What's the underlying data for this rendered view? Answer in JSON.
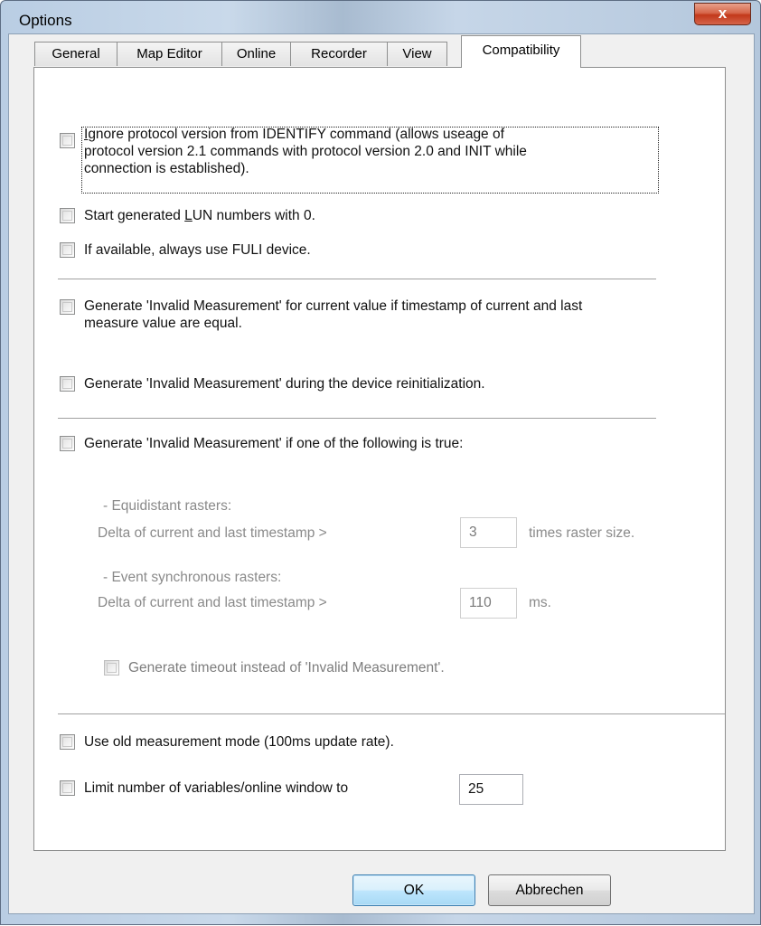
{
  "window": {
    "title": "Options",
    "close_glyph": "x"
  },
  "tabs": [
    {
      "label": "General"
    },
    {
      "label": "Map Editor"
    },
    {
      "label": "Online"
    },
    {
      "label": "Recorder"
    },
    {
      "label": "View"
    },
    {
      "label": "Compatibility",
      "active": true
    }
  ],
  "compatibility": {
    "ignore_protocol": {
      "line1_rest": "gnore protocol version from IDENTIFY command (allows useage of",
      "line1_mnemonic": "I",
      "line2": "protocol version 2.1 commands with protocol version 2.0 and INIT while",
      "line3": "connection is established).",
      "checked": false
    },
    "start_lun": {
      "prefix": "Start generated ",
      "mnemonic": "L",
      "suffix": "UN numbers with 0.",
      "checked": false
    },
    "fuli": {
      "label": "If available, always use FULI device.",
      "checked": false
    },
    "invalid_equal_ts": {
      "line1": "Generate 'Invalid Measurement' for current value if timestamp of current and last",
      "line2": "measure value are equal.",
      "checked": false
    },
    "invalid_reinit": {
      "label": "Generate 'Invalid Measurement' during the device reinitialization.",
      "checked": false
    },
    "invalid_conditions": {
      "label": "Generate 'Invalid Measurement' if one of the following is true:",
      "checked": false
    },
    "equidistant": {
      "heading": "- Equidistant rasters:",
      "delta_label": "Delta of current and last timestamp >",
      "value": "3",
      "unit": "times raster size."
    },
    "event_sync": {
      "heading": "- Event synchronous rasters:",
      "delta_label": "Delta of current and last timestamp >",
      "value": "110",
      "unit": "ms."
    },
    "timeout_instead": {
      "label": "Generate timeout instead of 'Invalid Measurement'.",
      "checked": false
    },
    "old_measurement": {
      "label": "Use old measurement mode (100ms update rate).",
      "checked": false
    },
    "limit_vars": {
      "label": "Limit number of variables/online window to",
      "value": "25",
      "checked": false
    }
  },
  "buttons": {
    "ok": "OK",
    "cancel": "Abbrechen"
  }
}
